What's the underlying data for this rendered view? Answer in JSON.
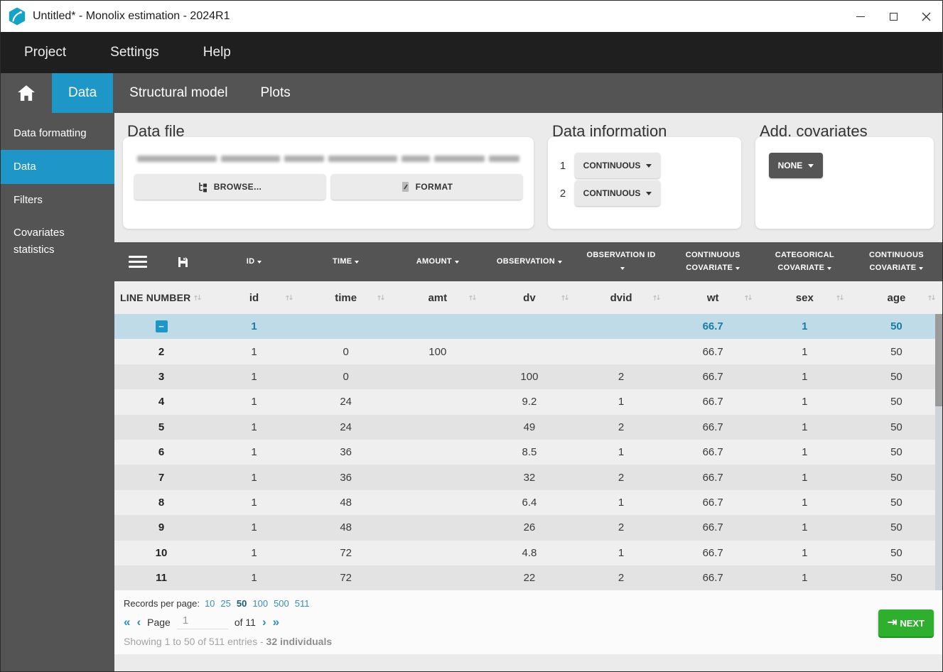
{
  "window": {
    "title": "Untitled* - Monolix estimation - 2024R1"
  },
  "menu": {
    "items": [
      "Project",
      "Settings",
      "Help"
    ]
  },
  "tabs": {
    "items": [
      {
        "label": "Data",
        "active": true
      },
      {
        "label": "Structural model",
        "active": false
      },
      {
        "label": "Plots",
        "active": false
      }
    ]
  },
  "sidebar": {
    "items": [
      {
        "label": "Data formatting",
        "active": false
      },
      {
        "label": "Data",
        "active": true
      },
      {
        "label": "Filters",
        "active": false
      },
      {
        "label": "Covariates statistics",
        "active": false
      }
    ]
  },
  "data_file": {
    "title": "Data file",
    "browse_label": "BROWSE...",
    "format_label": "FORMAT"
  },
  "data_information": {
    "title": "Data information",
    "rows": [
      {
        "index": "1",
        "value": "CONTINUOUS"
      },
      {
        "index": "2",
        "value": "CONTINUOUS"
      }
    ]
  },
  "add_covariates": {
    "title": "Add. covariates",
    "value": "NONE"
  },
  "table": {
    "header_tags": [
      "ID",
      "TIME",
      "AMOUNT",
      "OBSERVATION",
      "OBSERVATION ID",
      "CONTINUOUS COVARIATE",
      "CATEGORICAL COVARIATE",
      "CONTINUOUS COVARIATE"
    ],
    "columns": [
      "LINE NUMBER",
      "id",
      "time",
      "amt",
      "dv",
      "dvid",
      "wt",
      "sex",
      "age"
    ],
    "rows": [
      {
        "selected": true,
        "line": "",
        "id": "1",
        "time": "",
        "amt": "",
        "dv": "",
        "dvid": "",
        "wt": "66.7",
        "sex": "1",
        "age": "50"
      },
      {
        "selected": false,
        "line": "2",
        "id": "1",
        "time": "0",
        "amt": "100",
        "dv": "",
        "dvid": "",
        "wt": "66.7",
        "sex": "1",
        "age": "50"
      },
      {
        "selected": false,
        "line": "3",
        "id": "1",
        "time": "0",
        "amt": "",
        "dv": "100",
        "dvid": "2",
        "wt": "66.7",
        "sex": "1",
        "age": "50"
      },
      {
        "selected": false,
        "line": "4",
        "id": "1",
        "time": "24",
        "amt": "",
        "dv": "9.2",
        "dvid": "1",
        "wt": "66.7",
        "sex": "1",
        "age": "50"
      },
      {
        "selected": false,
        "line": "5",
        "id": "1",
        "time": "24",
        "amt": "",
        "dv": "49",
        "dvid": "2",
        "wt": "66.7",
        "sex": "1",
        "age": "50"
      },
      {
        "selected": false,
        "line": "6",
        "id": "1",
        "time": "36",
        "amt": "",
        "dv": "8.5",
        "dvid": "1",
        "wt": "66.7",
        "sex": "1",
        "age": "50"
      },
      {
        "selected": false,
        "line": "7",
        "id": "1",
        "time": "36",
        "amt": "",
        "dv": "32",
        "dvid": "2",
        "wt": "66.7",
        "sex": "1",
        "age": "50"
      },
      {
        "selected": false,
        "line": "8",
        "id": "1",
        "time": "48",
        "amt": "",
        "dv": "6.4",
        "dvid": "1",
        "wt": "66.7",
        "sex": "1",
        "age": "50"
      },
      {
        "selected": false,
        "line": "9",
        "id": "1",
        "time": "48",
        "amt": "",
        "dv": "26",
        "dvid": "2",
        "wt": "66.7",
        "sex": "1",
        "age": "50"
      },
      {
        "selected": false,
        "line": "10",
        "id": "1",
        "time": "72",
        "amt": "",
        "dv": "4.8",
        "dvid": "1",
        "wt": "66.7",
        "sex": "1",
        "age": "50"
      },
      {
        "selected": false,
        "line": "11",
        "id": "1",
        "time": "72",
        "amt": "",
        "dv": "22",
        "dvid": "2",
        "wt": "66.7",
        "sex": "1",
        "age": "50"
      }
    ]
  },
  "footer": {
    "records_label": "Records per page:",
    "records_options": [
      "10",
      "25",
      "50",
      "100",
      "500",
      "511"
    ],
    "records_active": "50",
    "page_label": "Page",
    "page_value": "1",
    "of_label": "of 11",
    "showing_text": "Showing 1 to 50 of 511 entries - ",
    "individuals_text": "32 individuals"
  },
  "next_button": {
    "label": "NEXT"
  },
  "colors": {
    "accent_blue": "#1e96c8",
    "header_gray": "#545454",
    "selected_row": "#bfdbe7",
    "next_green": "#2eb02e"
  }
}
